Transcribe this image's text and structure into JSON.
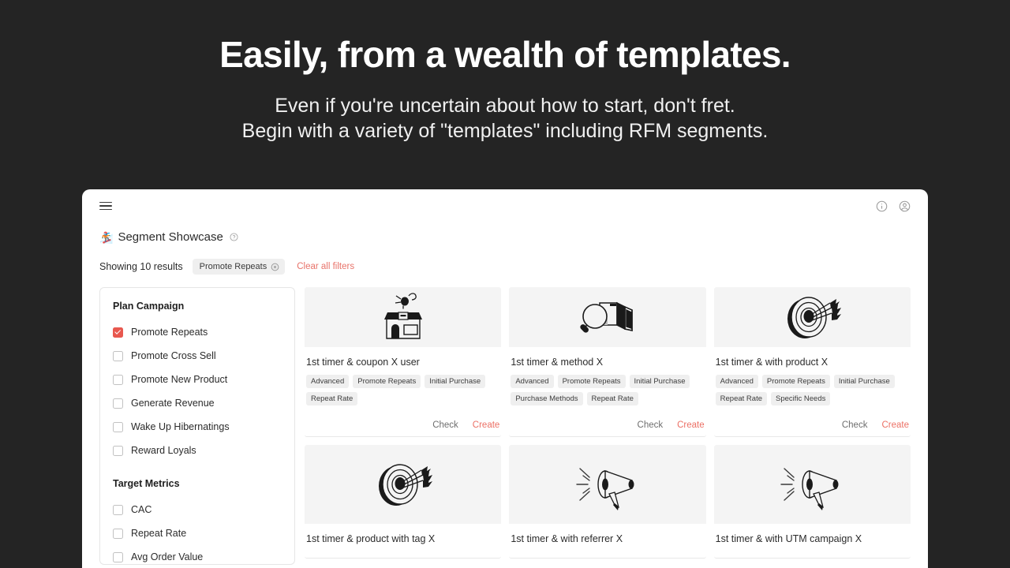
{
  "hero": {
    "title": "Easily, from a wealth of templates.",
    "sub_line1": "Even if you're uncertain about how to start, don't fret.",
    "sub_line2": "Begin with a variety of \"templates\" including RFM segments."
  },
  "topbar": {
    "menu_icon": "hamburger-menu-icon",
    "info_icon": "info-circle-icon",
    "account_icon": "user-account-icon"
  },
  "page": {
    "emoji": "🏂",
    "title": "Segment Showcase",
    "help_icon": "help-circle-icon"
  },
  "filters": {
    "results_text": "Showing 10 results",
    "active_chip": "Promote Repeats",
    "chip_remove_icon": "chip-remove-icon",
    "clear_all": "Clear all filters",
    "accent_color": "#e8736a"
  },
  "sidebar": {
    "groups": [
      {
        "title": "Plan Campaign",
        "options": [
          {
            "label": "Promote Repeats",
            "checked": true
          },
          {
            "label": "Promote Cross Sell",
            "checked": false
          },
          {
            "label": "Promote New Product",
            "checked": false
          },
          {
            "label": "Generate Revenue",
            "checked": false
          },
          {
            "label": "Wake Up Hibernatings",
            "checked": false
          },
          {
            "label": "Reward Loyals",
            "checked": false
          }
        ]
      },
      {
        "title": "Target Metrics",
        "options": [
          {
            "label": "CAC",
            "checked": false
          },
          {
            "label": "Repeat Rate",
            "checked": false
          },
          {
            "label": "Avg Order Value",
            "checked": false
          }
        ]
      }
    ],
    "checked_color": "#e8584f"
  },
  "actions": {
    "check_label": "Check",
    "create_label": "Create",
    "create_color": "#ec7065"
  },
  "cards": [
    {
      "title": "1st timer & coupon X user",
      "illustration": "storefront-icon",
      "tags": [
        "Advanced",
        "Promote Repeats",
        "Initial Purchase",
        "Repeat Rate"
      ]
    },
    {
      "title": "1st timer & method X",
      "illustration": "magnifier-documents-icon",
      "tags": [
        "Advanced",
        "Promote Repeats",
        "Initial Purchase",
        "Purchase Methods",
        "Repeat Rate"
      ]
    },
    {
      "title": "1st timer & with product X",
      "illustration": "target-arrows-icon",
      "tags": [
        "Advanced",
        "Promote Repeats",
        "Initial Purchase",
        "Repeat Rate",
        "Specific Needs"
      ]
    },
    {
      "title": "1st timer & product with tag X",
      "illustration": "target-arrows-icon",
      "tags": []
    },
    {
      "title": "1st timer & with referrer X",
      "illustration": "megaphone-icon",
      "tags": []
    },
    {
      "title": "1st timer & with UTM campaign X",
      "illustration": "megaphone-icon",
      "tags": []
    }
  ]
}
